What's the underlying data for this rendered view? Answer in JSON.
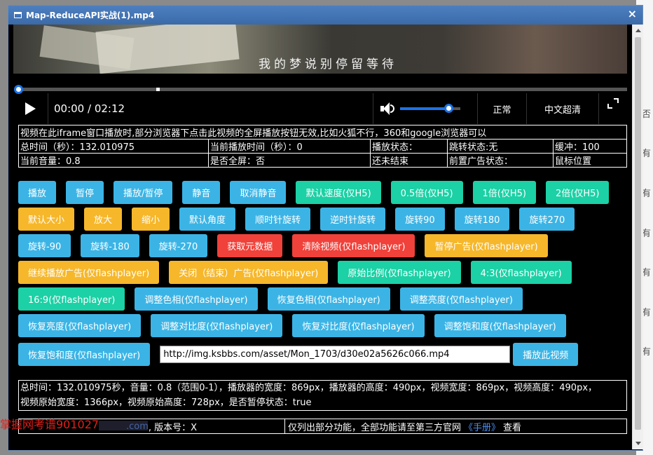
{
  "backdrop": {
    "cells": [
      "否",
      "有",
      "有",
      "有",
      "有",
      "有",
      "有"
    ]
  },
  "window": {
    "title": "Map-ReduceAPI实战(1).mp4",
    "close_glyph": "×"
  },
  "video": {
    "subtitle": "我的梦说别停留等待"
  },
  "player": {
    "time": "00:00 / 02:12",
    "volume_level": 0.8,
    "speed_label": "正常",
    "quality_label": "中文超清"
  },
  "info_table": {
    "line1": "视频在此iframe窗口播放时,部分浏览器下点击此视频的全屏播放按钮无效,比如火狐不行，360和google浏览器可以",
    "rows": [
      [
        "总时间（秒）：132.010975",
        "当前播放时间（秒）：0",
        "播放状态：",
        "跳转状态:无",
        "缓冲：100"
      ],
      [
        "当前音量：0.8",
        "是否全屏：否",
        "还未结束",
        "前置广告状态：",
        "鼠标位置"
      ]
    ]
  },
  "buttons": {
    "row1": [
      {
        "label": "播放",
        "color": "blue"
      },
      {
        "label": "暂停",
        "color": "blue"
      },
      {
        "label": "播放/暂停",
        "color": "blue"
      },
      {
        "label": "静音",
        "color": "blue"
      },
      {
        "label": "取消静音",
        "color": "blue"
      },
      {
        "label": "默认速度(仅H5)",
        "color": "green"
      },
      {
        "label": "0.5倍(仅H5)",
        "color": "green"
      },
      {
        "label": "1倍(仅H5)",
        "color": "green"
      },
      {
        "label": "2倍(仅H5)",
        "color": "green"
      }
    ],
    "row2": [
      {
        "label": "默认大小",
        "color": "orange"
      },
      {
        "label": "放大",
        "color": "orange"
      },
      {
        "label": "缩小",
        "color": "orange"
      },
      {
        "label": "默认角度",
        "color": "blue"
      },
      {
        "label": "顺时针旋转",
        "color": "blue"
      },
      {
        "label": "逆时针旋转",
        "color": "blue"
      },
      {
        "label": "旋转90",
        "color": "blue"
      },
      {
        "label": "旋转180",
        "color": "blue"
      },
      {
        "label": "旋转270",
        "color": "blue"
      }
    ],
    "row3": [
      {
        "label": "旋转-90",
        "color": "blue"
      },
      {
        "label": "旋转-180",
        "color": "blue"
      },
      {
        "label": "旋转-270",
        "color": "blue"
      },
      {
        "label": "获取元数据",
        "color": "red"
      },
      {
        "label": "清除视频(仅flashplayer)",
        "color": "red"
      },
      {
        "label": "暂停广告(仅flashplayer)",
        "color": "orange"
      }
    ],
    "row4": [
      {
        "label": "继续播放广告(仅flashplayer)",
        "color": "orange"
      },
      {
        "label": "关闭（结束）广告(仅flashplayer)",
        "color": "orange"
      },
      {
        "label": "原始比例(仅flashplayer)",
        "color": "green"
      },
      {
        "label": "4:3(仅flashplayer)",
        "color": "green"
      }
    ],
    "row5": [
      {
        "label": "16:9(仅flashplayer)",
        "color": "green"
      },
      {
        "label": "调整色相(仅flashplayer)",
        "color": "blue"
      },
      {
        "label": "恢复色相(仅flashplayer)",
        "color": "blue"
      },
      {
        "label": "调整亮度(仅flashplayer)",
        "color": "blue"
      }
    ],
    "row6": [
      {
        "label": "恢复亮度(仅flashplayer)",
        "color": "blue"
      },
      {
        "label": "调整对比度(仅flashplayer)",
        "color": "blue"
      },
      {
        "label": "恢复对比度(仅flashplayer)",
        "color": "blue"
      },
      {
        "label": "调整饱和度(仅flashplayer)",
        "color": "blue"
      }
    ],
    "restore_saturation": "恢复饱和度(仅flashplayer)",
    "play_url_label": "播放此视频"
  },
  "url_input": {
    "value": "http://img.ksbbs.com/asset/Mon_1703/d30e02a5626c066.mp4"
  },
  "stats": {
    "line1": "总时间：132.010975秒，音量：0.8（范围0-1），播放器的宽度：869px，播放器的高度：490px，视频宽度：869px，视频高度：490px，",
    "line2": "视频原始宽度：1366px，视频原始高度：728px，是否暂停状态：true"
  },
  "footer": {
    "site_suffix": ".com",
    "version": ", 版本号：X",
    "note_prefix": "仅列出部分功能，全部功能请至第三方官网",
    "link": "《手册》",
    "note_suffix": "查看"
  },
  "watermark": {
    "text": "掌握网考谱901027"
  },
  "colors": {
    "blue": "#3bb4e5",
    "green": "#1bd1a5",
    "orange": "#f6b72b",
    "red": "#f0413a",
    "accent": "#1a73e8"
  }
}
